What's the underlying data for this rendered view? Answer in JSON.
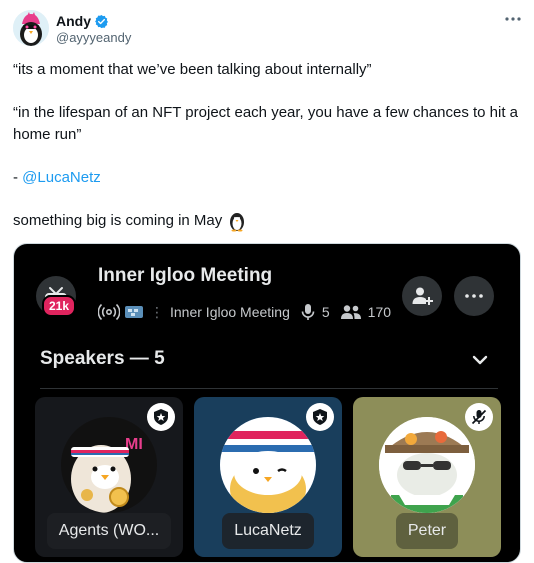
{
  "author": {
    "display_name": "Andy",
    "handle": "@ayyyeandy",
    "verified": true
  },
  "tweet": {
    "line1": "“its a moment that we’ve been talking about internally”",
    "line2": "“in the lifespan of an NFT project each year, you have a few chances to hit a home run”",
    "line3_prefix": "- ",
    "mention": "@LucaNetz",
    "line4": "something big is coming in May"
  },
  "space": {
    "title": "Inner Igloo Meeting",
    "listener_badge": "21k",
    "host_label": "Inner Igloo Meeting",
    "speaker_count": "5",
    "listener_count": "170",
    "speakers_header": "Speakers — 5",
    "speakers": [
      {
        "name": "Agents (WO...",
        "badge": "host-star"
      },
      {
        "name": "LucaNetz",
        "badge": "host-star"
      },
      {
        "name": "Peter",
        "badge": "muted-mic"
      }
    ]
  },
  "colors": {
    "link": "#1d9bf0",
    "card_bg": "#000000",
    "tile_blue": "#193e5c",
    "tile_olive": "#8d8e59",
    "badge_red": "#e0245e"
  }
}
